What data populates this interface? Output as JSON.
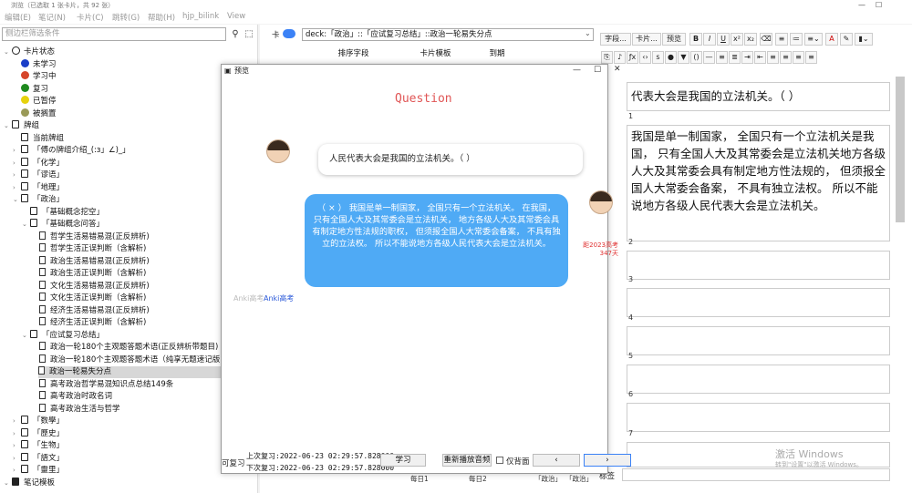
{
  "window": {
    "title": "浏览（已选取 1 张卡片，共 92 张）",
    "min": "—",
    "max": "☐"
  },
  "menu": [
    "编辑(E)",
    "笔记(N)",
    "卡片(C)",
    "跳转(G)",
    "帮助(H)",
    "hjp_bilink",
    "View"
  ],
  "sidebar": {
    "search_placeholder": "侧边栏筛选条件",
    "search_icon": "magnifier-icon",
    "select_icon": "selection-icon",
    "items": [
      {
        "level": 0,
        "arrow": "⌄",
        "icon": "circle",
        "label": "卡片状态"
      },
      {
        "level": 1,
        "icon": "dot",
        "color": "#1a3ec8",
        "label": "未学习"
      },
      {
        "level": 1,
        "icon": "dot",
        "color": "#d6452a",
        "label": "学习中"
      },
      {
        "level": 1,
        "icon": "dot",
        "color": "#1f8a1f",
        "label": "复习"
      },
      {
        "level": 1,
        "icon": "dot",
        "color": "#e6d20d",
        "label": "已暂停"
      },
      {
        "level": 1,
        "icon": "dot",
        "color": "#9a9a58",
        "label": "被搁置"
      },
      {
        "level": 0,
        "arrow": "⌄",
        "icon": "deck",
        "label": "牌组"
      },
      {
        "level": 1,
        "icon": "deck",
        "label": "当前牌组"
      },
      {
        "level": 1,
        "arrow": "›",
        "icon": "deck",
        "label": "「傅の牌组介绍_(:з」∠)_」"
      },
      {
        "level": 1,
        "arrow": "›",
        "icon": "deck",
        "label": "「化学」"
      },
      {
        "level": 1,
        "arrow": "›",
        "icon": "deck",
        "label": "「谬语」"
      },
      {
        "level": 1,
        "arrow": "›",
        "icon": "deck",
        "label": "「地理」"
      },
      {
        "level": 1,
        "arrow": "⌄",
        "icon": "deck",
        "label": "「政治」"
      },
      {
        "level": 2,
        "icon": "deck",
        "label": "「基础概念挖空」"
      },
      {
        "level": 2,
        "arrow": "⌄",
        "icon": "deck",
        "label": "「基础概念问答」"
      },
      {
        "level": 3,
        "icon": "card",
        "label": "哲学生活易错易混(正反辨析)"
      },
      {
        "level": 3,
        "icon": "card",
        "label": "哲学生活正误判断（含解析)"
      },
      {
        "level": 3,
        "icon": "card",
        "label": "政治生活易错易混(正反辨析)"
      },
      {
        "level": 3,
        "icon": "card",
        "label": "政治生活正误判断（含解析)"
      },
      {
        "level": 3,
        "icon": "card",
        "label": "文化生活易错易混(正反辨析)"
      },
      {
        "level": 3,
        "icon": "card",
        "label": "文化生活正误判断（含解析)"
      },
      {
        "level": 3,
        "icon": "card",
        "label": "经济生活易错易混(正反辨析)"
      },
      {
        "level": 3,
        "icon": "card",
        "label": "经济生活正误判断（含解析)"
      },
      {
        "level": 2,
        "arrow": "⌄",
        "icon": "deck",
        "label": "「应试复习总结」"
      },
      {
        "level": 3,
        "icon": "card",
        "label": "政治一轮180个主观题答题术语(正反辨析带题目)"
      },
      {
        "level": 3,
        "icon": "card",
        "label": "政治一轮180个主观题答题术语（纯享无题速记版)"
      },
      {
        "level": 3,
        "icon": "card",
        "label": "政治一轮易失分点",
        "selected": true
      },
      {
        "level": 3,
        "icon": "card",
        "label": "高考政治哲学易混知识点总结149条"
      },
      {
        "level": 3,
        "icon": "card",
        "label": "高考政治时政名词"
      },
      {
        "level": 3,
        "icon": "card",
        "label": "高考政治生活与哲学"
      },
      {
        "level": 1,
        "arrow": "›",
        "icon": "deck",
        "label": "「数學」"
      },
      {
        "level": 1,
        "arrow": "›",
        "icon": "deck",
        "label": "「歷史」"
      },
      {
        "level": 1,
        "arrow": "›",
        "icon": "deck",
        "label": "「生物」"
      },
      {
        "level": 1,
        "arrow": "›",
        "icon": "deck",
        "label": "「語文」"
      },
      {
        "level": 1,
        "arrow": "›",
        "icon": "deck",
        "label": "「靈里」"
      },
      {
        "level": 0,
        "arrow": "⌄",
        "icon": "notetype",
        "label": "笔记模板"
      }
    ]
  },
  "browser": {
    "toggle_label": "卡",
    "query": "deck:「政治」::「应试复习总结」::政治一轮易失分点",
    "columns": [
      "排序字段",
      "卡片模板",
      "到期"
    ],
    "bottom_cells": [
      "每日1",
      "每日2",
      "「政治」",
      "「政治」"
    ]
  },
  "editor": {
    "buttons": [
      "字段...",
      "卡片...",
      "预览"
    ],
    "format_buttons": [
      "B",
      "I",
      "U",
      "x²",
      "x₂"
    ],
    "field_label": "标签",
    "fields": [
      {
        "num": "",
        "text": "代表大会是我国的立法机关。（ ）"
      },
      {
        "num": "1",
        "text": "我国是单一制国家， 全国只有一个立法机关是我国， 只有全国人大及其常委会是立法机关地方各级人大及其常委会具有制定地方性法规的， 但须报全国人大常委会备案， 不具有独立法权。 所以不能说地方各级人民代表大会是立法机关。"
      },
      {
        "num": "2",
        "text": ""
      },
      {
        "num": "3",
        "text": ""
      },
      {
        "num": "4",
        "text": ""
      },
      {
        "num": "5",
        "text": ""
      },
      {
        "num": "6",
        "text": ""
      },
      {
        "num": "7",
        "text": ""
      }
    ]
  },
  "preview": {
    "title": "预览",
    "heading": "Question",
    "question": "人民代表大会是我国的立法机关。（ ）",
    "answer": "（ × ） 我国是单一制国家， 全国只有一个立法机关。 在我国， 只有全国人大及其常委会是立法机关， 地方各级人大及其常委会具有制定地方性法规的职权， 但须报全国人大常委会备案， 不具有独立的立法权。 所以不能说地方各级人民代表大会是立法机关。",
    "countdown_line1": "距2023高考",
    "countdown_line2": "347天",
    "anki_text": "Anki高考",
    "anki_faint": "Anki高考",
    "review_label": "可复习",
    "last_review": "上次复习:2022-06-23 02:29:57.828000",
    "next_review": "下次复习:2022-06-23 02:29:57.828000",
    "study_button": "学习",
    "replay_button": "重新播放音频",
    "back_only_label": "仅背面",
    "prev": "‹",
    "next": "›"
  },
  "watermark": {
    "line1": "激活 Windows",
    "line2": "转到\"设置\"以激活 Windows。"
  }
}
